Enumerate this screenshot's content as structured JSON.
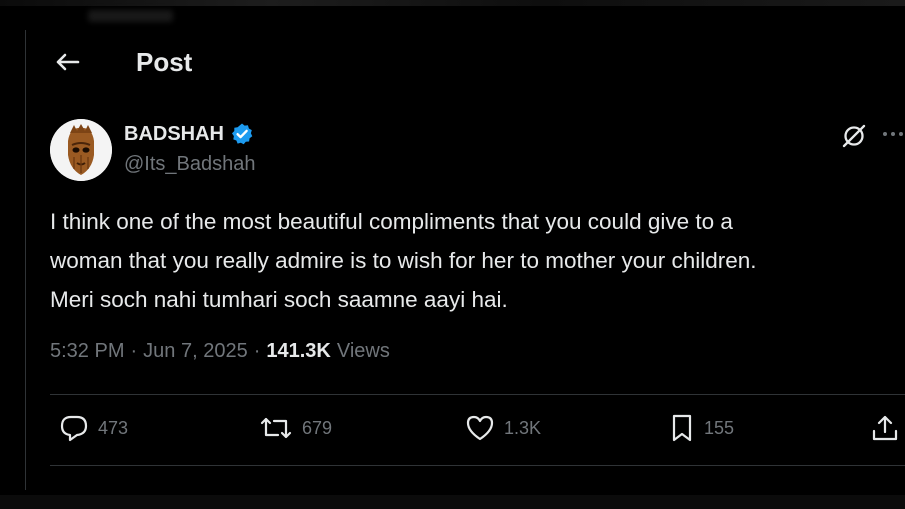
{
  "header": {
    "title": "Post"
  },
  "author": {
    "name": "BADSHAH",
    "handle": "@Its_Badshah"
  },
  "tweet": {
    "text": "I think one of the most beautiful compliments that you could give to a\nwoman that you really admire is to wish for her to mother your children.\nMeri soch nahi tumhari soch saamne aayi hai."
  },
  "meta": {
    "time": "5:32 PM",
    "date": "Jun 7, 2025",
    "views_count": "141.3K",
    "views_label": "Views",
    "separator": "·"
  },
  "actions": {
    "replies": "473",
    "reposts": "679",
    "likes": "1.3K",
    "bookmarks": "155"
  },
  "icons": {
    "back": "arrow-left-icon",
    "verified": "verified-badge-icon",
    "grok": "grok-icon",
    "more": "more-icon",
    "reply": "reply-icon",
    "repost": "repost-icon",
    "like": "heart-icon",
    "bookmark": "bookmark-icon",
    "share": "share-icon"
  },
  "colors": {
    "background": "#000000",
    "text": "#e7e9ea",
    "muted": "#71767b",
    "verified": "#1d9bf0",
    "divider": "#2f3336"
  }
}
